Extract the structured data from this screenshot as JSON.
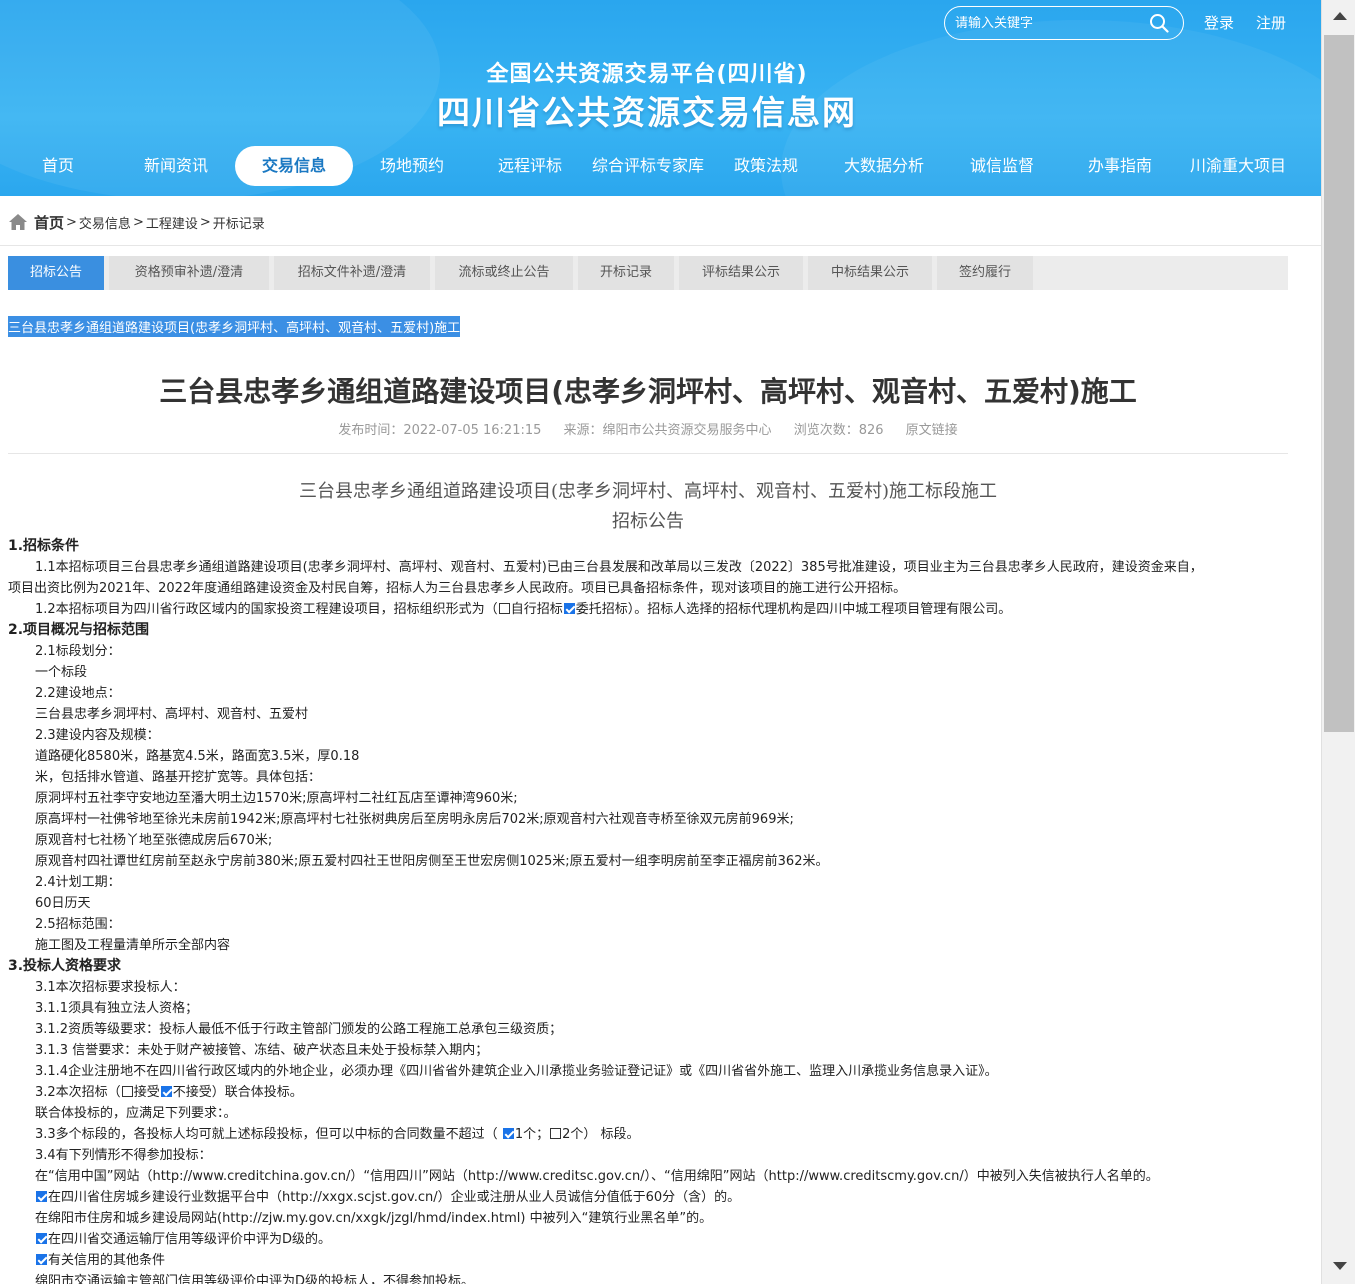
{
  "header": {
    "search_placeholder": "请输入关键字",
    "login": "登录",
    "register": "注册",
    "title_small": "全国公共资源交易平台(四川省)",
    "title_large": "四川省公共资源交易信息网",
    "nav": [
      "首页",
      "新闻资讯",
      "交易信息",
      "场地预约",
      "远程评标",
      "综合评标专家库",
      "政策法规",
      "大数据分析",
      "诚信监督",
      "办事指南",
      "川渝重大项目"
    ],
    "active_nav": "交易信息"
  },
  "breadcrumb": {
    "home": "首页",
    "items": [
      "交易信息",
      "工程建设",
      "开标记录"
    ]
  },
  "tabs": [
    "招标公告",
    "资格预审补遗/澄清",
    "招标文件补遗/澄清",
    "流标或终止公告",
    "开标记录",
    "评标结果公示",
    "中标结果公示",
    "签约履行"
  ],
  "selected_title": "三台县忠孝乡通组道路建设项目(忠孝乡洞坪村、高坪村、观音村、五爱村)施工",
  "article": {
    "title": "三台县忠孝乡通组道路建设项目(忠孝乡洞坪村、高坪村、观音村、五爱村)施工",
    "meta": {
      "publish": "发布时间：2022-07-05 16:21:15",
      "source": "来源：绵阳市公共资源交易服务中心",
      "views": "浏览次数：826",
      "origin_link": "原文链接"
    },
    "doc_title_1": "三台县忠孝乡通组道路建设项目(忠孝乡洞坪村、高坪村、观音村、五爱村)施工标段施工",
    "doc_title_2": "招标公告",
    "lines": {
      "s1": "1.招标条件",
      "l1a": "1.1本招标项目三台县忠孝乡通组道路建设项目(忠孝乡洞坪村、高坪村、观音村、五爱村)已由三台县发展和改革局以三发改〔2022〕385号批准建设，项目业主为三台县忠孝乡人民政府，建设资金来自，",
      "l1b": "项目出资比例为2021年、2022年度通组路建设资金及村民自筹，招标人为三台县忠孝乡人民政府。项目已具备招标条件，现对该项目的施工进行公开招标。",
      "l2a": "1.2本招标项目为四川省行政区域内的国家投资工程建设项目，招标组织形式为（",
      "l2b": "自行招标",
      "l2c": "委托招标）。招标人选择的招标代理机构是四川中城工程项目管理有限公司。",
      "s2": "2.项目概况与招标范围",
      "l3": "2.1标段划分：",
      "l4": "一个标段",
      "l5": "2.2建设地点：",
      "l6": "三台县忠孝乡洞坪村、高坪村、观音村、五爱村",
      "l7": "2.3建设内容及规模：",
      "l8": "道路硬化8580米，路基宽4.5米，路面宽3.5米，厚0.18",
      "l9": "米，包括排水管道、路基开挖扩宽等。具体包括：",
      "l10": "原洞坪村五社李守安地边至潘大明土边1570米;原高坪村二社红瓦店至谭神湾960米;",
      "l11": "原高坪村一社佛爷地至徐光未房前1942米;原高坪村七社张树典房后至房明永房后702米;原观音村六社观音寺桥至徐双元房前969米;",
      "l12": "原观音村七社杨丫地至张德成房后670米;",
      "l13": "原观音村四社谭世红房前至赵永宁房前380米;原五爱村四社王世阳房侧至王世宏房侧1025米;原五爱村一组李明房前至李正福房前362米。",
      "l14": "2.4计划工期：",
      "l15": "60日历天",
      "l16": "2.5招标范围：",
      "l17": "施工图及工程量清单所示全部内容",
      "s3": "3.投标人资格要求",
      "l18": "3.1本次招标要求投标人：",
      "l19": "3.1.1须具有独立法人资格；",
      "l20": "3.1.2资质等级要求：投标人最低不低于行政主管部门颁发的公路工程施工总承包三级资质；",
      "l21": "3.1.3 信誉要求：未处于财产被接管、冻结、破产状态且未处于投标禁入期内；",
      "l22": "3.1.4企业注册地不在四川省行政区域内的外地企业，必须办理《四川省省外建筑企业入川承揽业务验证登记证》或《四川省省外施工、监理入川承揽业务信息录入证》。",
      "l23a": "3.2本次招标（",
      "l23b": "接受",
      "l23c": "不接受）联合体投标。",
      "l24": "联合体投标的，应满足下列要求：。",
      "l25a": "3.3多个标段的，各投标人均可就上述标段投标，但可以中标的合同数量不超过（ ",
      "l25b": "1个；",
      "l25c": "2个） 标段。",
      "l26": "3.4有下列情形不得参加投标：",
      "l27": "在“信用中国”网站（http://www.creditchina.gov.cn/）“信用四川”网站（http://www.creditsc.gov.cn/）、“信用绵阳”网站（http://www.creditscmy.gov.cn/）中被列入失信被执行人名单的。",
      "l28": "在四川省住房城乡建设行业数据平台中（http://xxgx.scjst.gov.cn/）企业或注册从业人员诚信分值低于60分（含）的。",
      "l29": "在绵阳市住房和城乡建设局网站(http://zjw.my.gov.cn/xxgk/jzgl/hmd/index.html) 中被列入“建筑行业黑名单”的。",
      "l30": "在四川省交通运输厅信用等级评价中评为D级的。",
      "l31": "有关信用的其他条件",
      "l32": "绵阳市交通运输主管部门信用等级评价中评为D级的投标人，不得参加投标。"
    }
  }
}
